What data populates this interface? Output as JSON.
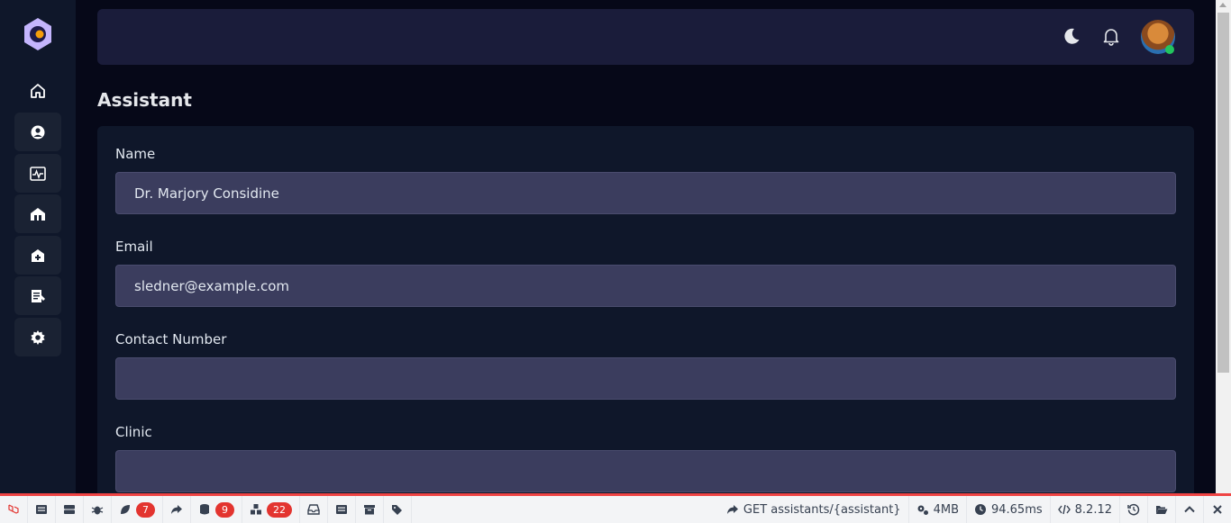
{
  "page": {
    "title": "Assistant"
  },
  "sidebar": {
    "items": [
      {
        "name": "home-icon"
      },
      {
        "name": "user-circle-icon"
      },
      {
        "name": "activity-monitor-icon"
      },
      {
        "name": "clinic-building-icon"
      },
      {
        "name": "medical-house-icon"
      },
      {
        "name": "notes-edit-icon"
      },
      {
        "name": "gear-icon"
      }
    ]
  },
  "header": {
    "icons": [
      "moon-icon",
      "bell-icon",
      "avatar"
    ]
  },
  "form": {
    "name_label": "Name",
    "name_value": "Dr. Marjory Considine",
    "email_label": "Email",
    "email_value": "sledner@example.com",
    "contact_label": "Contact Number",
    "contact_value": "",
    "clinic_label": "Clinic",
    "clinic_value": ""
  },
  "debugbar": {
    "badge_1": "7",
    "badge_2": "9",
    "badge_3": "22",
    "route": "GET assistants/{assistant}",
    "memory": "4MB",
    "time": "94.65ms",
    "php_version": "8.2.12"
  },
  "colors": {
    "accent": "#e3342f",
    "card": "#0f172a",
    "input": "#3b3d5e"
  }
}
